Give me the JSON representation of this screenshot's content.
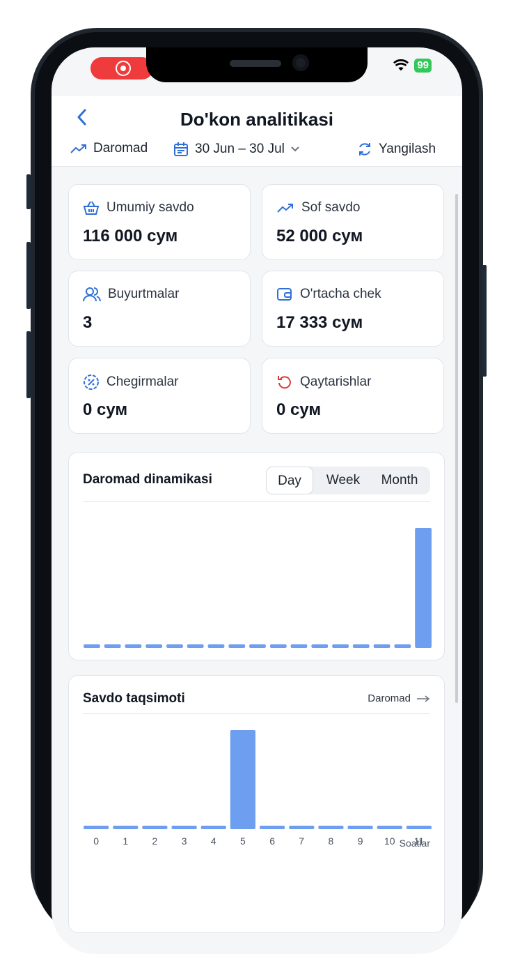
{
  "status_bar": {
    "battery": "99"
  },
  "header": {
    "title": "Do'kon analitikasi",
    "metric_label": "Daromad",
    "date_range": "30 Jun – 30 Jul",
    "refresh_label": "Yangilash"
  },
  "stats": [
    {
      "label": "Umumiy savdo",
      "value": "116 000 сум",
      "icon": "basket-icon"
    },
    {
      "label": "Sof savdo",
      "value": "52 000 сум",
      "icon": "trend-up-icon"
    },
    {
      "label": "Buyurtmalar",
      "value": "3",
      "icon": "users-icon"
    },
    {
      "label": "O'rtacha chek",
      "value": "17 333 сум",
      "icon": "wallet-icon"
    },
    {
      "label": "Chegirmalar",
      "value": "0 сум",
      "icon": "discount-icon"
    },
    {
      "label": "Qaytarishlar",
      "value": "0 сум",
      "icon": "undo-icon"
    }
  ],
  "revenue_chart": {
    "title": "Daromad dinamikasi",
    "tabs": [
      "Day",
      "Week",
      "Month"
    ],
    "active_tab": "Day"
  },
  "sales_chart": {
    "title": "Savdo taqsimoti",
    "link_label": "Daromad",
    "x_unit_label": "Soatlar"
  },
  "colors": {
    "accent": "#2f6fd6",
    "bar": "#6d9ef0",
    "danger": "#d93a3a"
  },
  "chart_data": [
    {
      "type": "bar",
      "title": "Daromad dinamikasi",
      "categories": [],
      "values": [
        0,
        0,
        0,
        0,
        0,
        0,
        0,
        0,
        0,
        0,
        0,
        0,
        0,
        0,
        0,
        0,
        116000
      ],
      "note_axis": ""
    },
    {
      "type": "bar",
      "title": "Savdo taqsimoti",
      "categories": [
        "0",
        "1",
        "2",
        "3",
        "4",
        "5",
        "6",
        "7",
        "8",
        "9",
        "10",
        "11"
      ],
      "values": [
        0,
        0,
        0,
        0,
        0,
        116000,
        0,
        0,
        0,
        0,
        0,
        0
      ],
      "xlabel": "Soatlar"
    }
  ]
}
